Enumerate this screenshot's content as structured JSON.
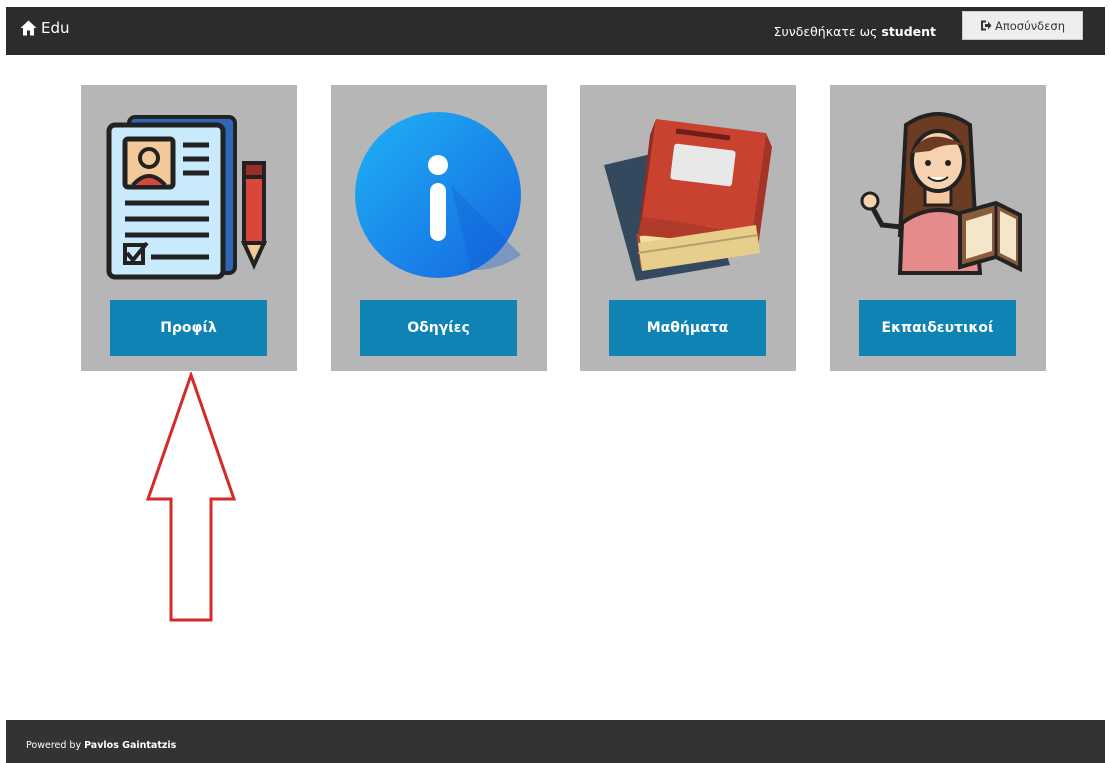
{
  "header": {
    "brand_icon": "home-icon",
    "brand_label": "Edu",
    "logged_in_prefix": "Συνδεθήκατε ως",
    "username": "student",
    "logout_icon": "sign-out-icon",
    "logout_label": "Αποσύνδεση"
  },
  "cards": [
    {
      "icon": "profile-document-icon",
      "label": "Προφίλ"
    },
    {
      "icon": "info-icon",
      "label": "Οδηγίες"
    },
    {
      "icon": "books-icon",
      "label": "Μαθήματα"
    },
    {
      "icon": "teacher-icon",
      "label": "Εκπαιδευτικοί"
    }
  ],
  "annotation": {
    "icon": "red-arrow-up-icon",
    "color": "#d42a2a"
  },
  "footer": {
    "prefix": "Powered by",
    "author": "Pavlos Gaintatzis"
  },
  "colors": {
    "bar": "#2c2c2c",
    "card_bg": "#b6b6b6",
    "button": "#0e83b4",
    "footer": "#333333"
  }
}
